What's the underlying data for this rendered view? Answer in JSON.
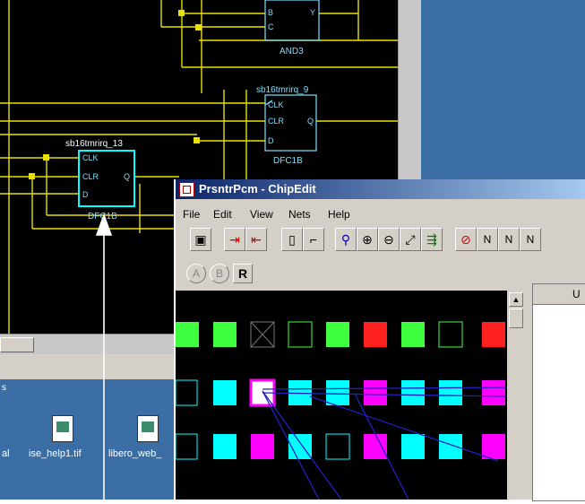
{
  "schematic": {
    "cells": [
      {
        "name": "sb16tmrirq_9",
        "type": "DFC1B",
        "pins": [
          "CLK",
          "CLR",
          "D",
          "Q"
        ]
      },
      {
        "name": "sb16tmrirq_13",
        "type": "DFC1B",
        "pins": [
          "CLK",
          "CLR",
          "D",
          "Q"
        ]
      },
      {
        "name": "",
        "type": "AND3",
        "pins": [
          "B",
          "C",
          "Y"
        ]
      }
    ]
  },
  "desktop": {
    "icons": [
      {
        "label": "al"
      },
      {
        "label": "ise_help1.tif"
      },
      {
        "label": "libero_web_"
      }
    ],
    "strip_text": "s"
  },
  "chipedit": {
    "title": "PrsntrPcm - ChipEdit",
    "menu": [
      "File",
      "Edit",
      "View",
      "Nets",
      "Help"
    ],
    "toolbar": [
      "N",
      "N",
      "N"
    ],
    "secondary": [
      "A",
      "B",
      "R"
    ],
    "right_header": "U"
  },
  "colors": {
    "schematic_wire": "#e8e000",
    "selected": "#00ffff",
    "desktop": "#3a6ea5"
  }
}
